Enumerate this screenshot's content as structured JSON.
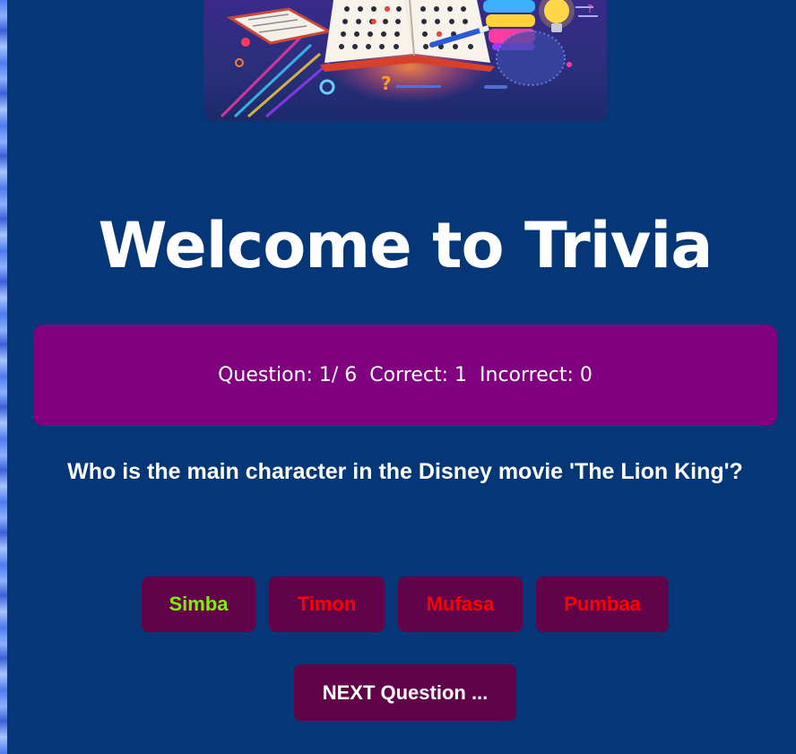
{
  "header": {
    "title": "Welcome to Trivia"
  },
  "score": {
    "question_label": "Question:",
    "question_current": "1",
    "question_total": "6",
    "correct_label": "Correct:",
    "correct_value": "1",
    "incorrect_label": "Incorrect:",
    "incorrect_value": "0"
  },
  "question": {
    "text": "Who is the main character in the Disney movie 'The Lion King'?"
  },
  "answers": [
    {
      "label": "Simba",
      "state": "correct"
    },
    {
      "label": "Timon",
      "state": "wrong"
    },
    {
      "label": "Mufasa",
      "state": "wrong"
    },
    {
      "label": "Pumbaa",
      "state": "wrong"
    }
  ],
  "next_button": {
    "label": "NEXT Question ..."
  },
  "colors": {
    "page_background": "#053677",
    "scoreboard_background": "#800080",
    "button_background": "#620349",
    "correct_answer_text": "#7ff000",
    "wrong_answer_text": "#ff0000",
    "text": "#ffffff"
  },
  "banner": {
    "icon": "trivia-book-illustration"
  }
}
